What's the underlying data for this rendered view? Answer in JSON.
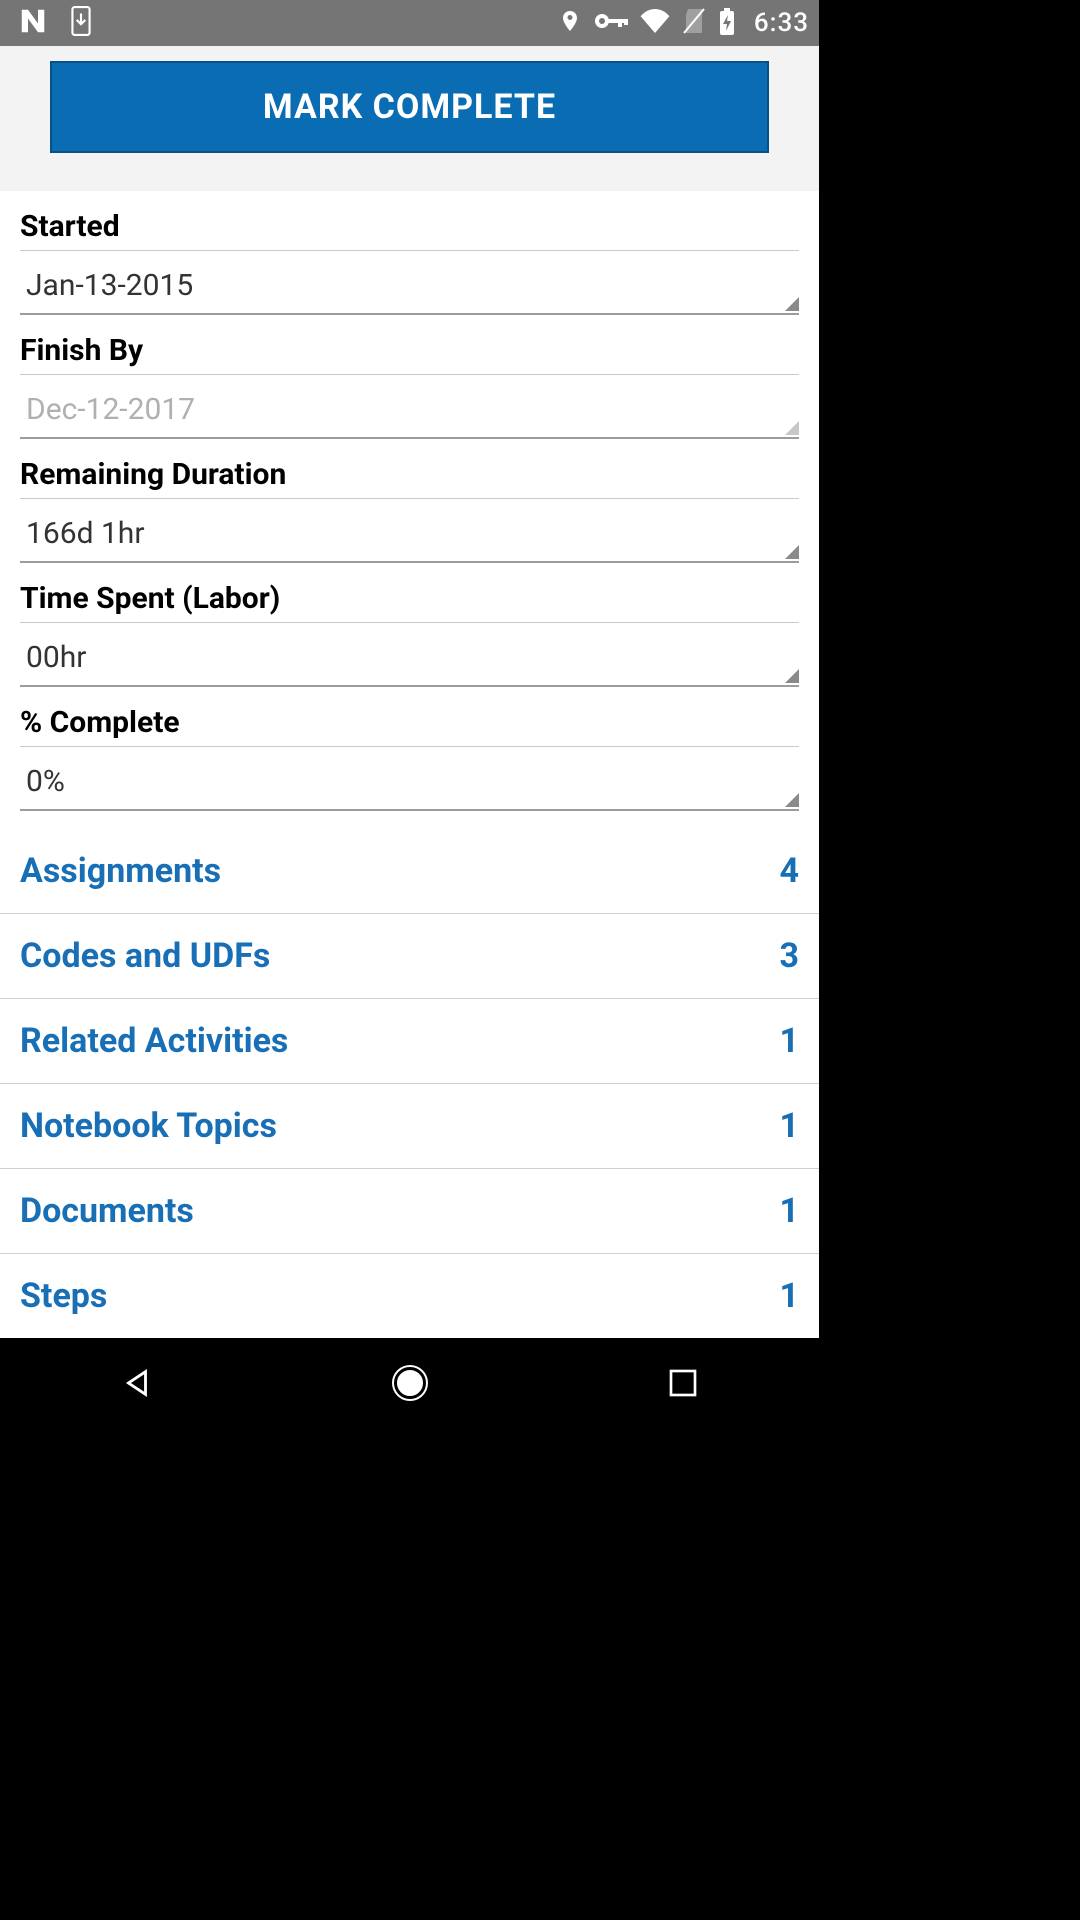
{
  "status": {
    "time": "6:33"
  },
  "header": {
    "mark_complete": "MARK COMPLETE"
  },
  "fields": {
    "started": {
      "label": "Started",
      "value": "Jan-13-2015"
    },
    "finish_by": {
      "label": "Finish By",
      "value": "Dec-12-2017"
    },
    "remaining_duration": {
      "label": "Remaining Duration",
      "value": "166d 1hr"
    },
    "time_spent": {
      "label": "Time Spent (Labor)",
      "value": "00hr"
    },
    "percent_complete": {
      "label": "% Complete",
      "value": "0%"
    }
  },
  "links": [
    {
      "label": "Assignments",
      "count": "4"
    },
    {
      "label": "Codes and UDFs",
      "count": "3"
    },
    {
      "label": "Related Activities",
      "count": "1"
    },
    {
      "label": "Notebook Topics",
      "count": "1"
    },
    {
      "label": "Documents",
      "count": "1"
    },
    {
      "label": "Steps",
      "count": "1"
    }
  ]
}
